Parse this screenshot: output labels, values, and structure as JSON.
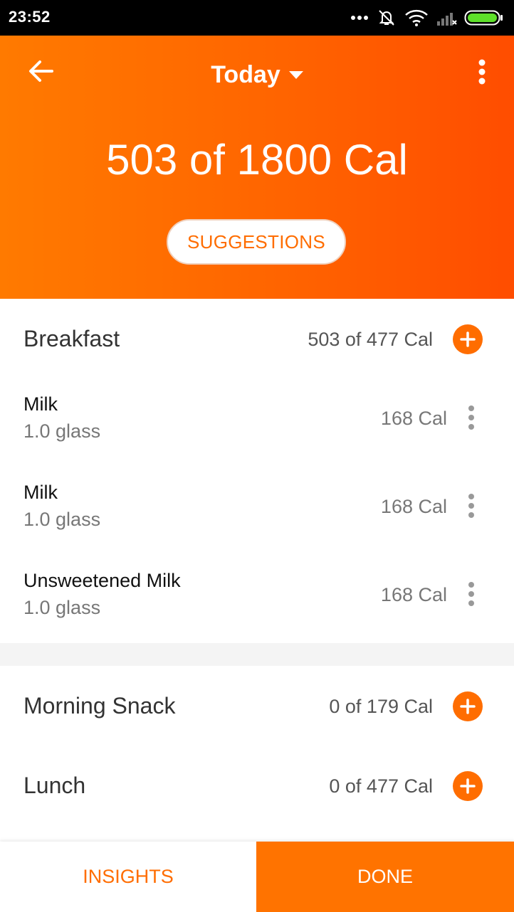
{
  "status_bar": {
    "time": "23:52",
    "icons": [
      "more-dots-icon",
      "alarm-off-icon",
      "wifi-icon",
      "signal-icon",
      "battery-icon"
    ]
  },
  "header": {
    "title": "Today",
    "calorie_summary": "503 of 1800 Cal",
    "suggestions_label": "SUGGESTIONS",
    "back_icon": "arrow-back-icon",
    "menu_icon": "more-vertical-icon",
    "dropdown_icon": "caret-down-icon"
  },
  "colors": {
    "accent": "#ff6d00",
    "header_gradient_start": "#ff7a00",
    "header_gradient_end": "#ff4d00"
  },
  "meals": {
    "breakfast": {
      "name": "Breakfast",
      "calories": "503 of 477 Cal",
      "items": [
        {
          "name": "Milk",
          "quantity": "1.0 glass",
          "calories": "168 Cal"
        },
        {
          "name": "Milk",
          "quantity": "1.0 glass",
          "calories": "168 Cal"
        },
        {
          "name": "Unsweetened Milk",
          "quantity": "1.0 glass",
          "calories": "168 Cal"
        }
      ]
    },
    "morning_snack": {
      "name": "Morning Snack",
      "calories": "0 of 179 Cal"
    },
    "lunch": {
      "name": "Lunch",
      "calories": "0 of 477 Cal"
    }
  },
  "bottom_bar": {
    "insights_label": "INSIGHTS",
    "done_label": "DONE"
  }
}
